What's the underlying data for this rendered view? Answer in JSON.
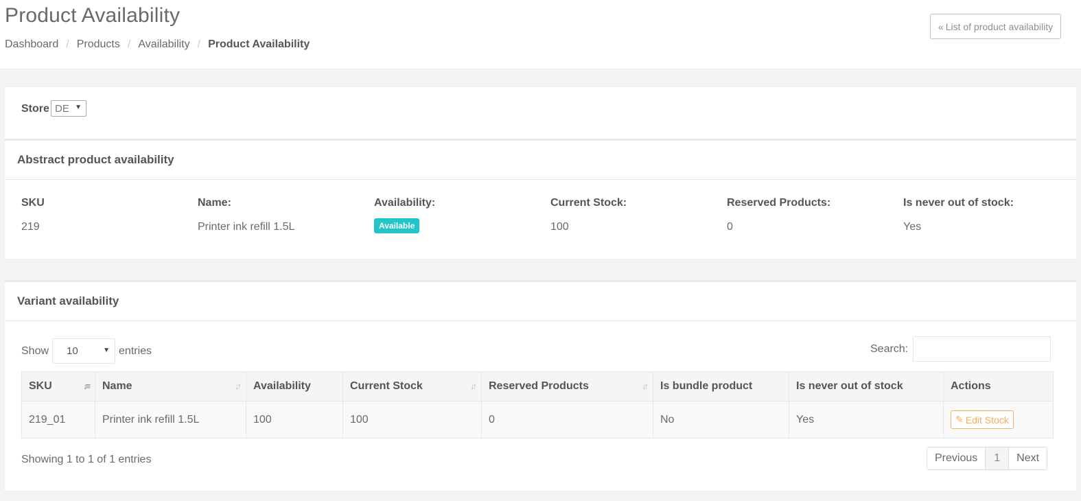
{
  "header": {
    "title": "Product Availability",
    "back_button": "List of product availability",
    "breadcrumb": [
      "Dashboard",
      "Products",
      "Availability",
      "Product Availability"
    ]
  },
  "store": {
    "label": "Store",
    "selected": "DE"
  },
  "abstract": {
    "title": "Abstract product availability",
    "columns": [
      "SKU",
      "Name:",
      "Availability:",
      "Current Stock:",
      "Reserved Products:",
      "Is never out of stock:"
    ],
    "values": {
      "sku": "219",
      "name": "Printer ink refill 1.5L",
      "availability": "Available",
      "current_stock": "100",
      "reserved": "0",
      "never_out": "Yes"
    }
  },
  "variant": {
    "title": "Variant availability",
    "show_label": "Show",
    "entries_label": "entries",
    "page_length": "10",
    "search_label": "Search:",
    "search_value": "",
    "columns": [
      "SKU",
      "Name",
      "Availability",
      "Current Stock",
      "Reserved Products",
      "Is bundle product",
      "Is never out of stock",
      "Actions"
    ],
    "rows": [
      {
        "sku": "219_01",
        "name": "Printer ink refill 1.5L",
        "availability": "100",
        "current_stock": "100",
        "reserved": "0",
        "bundle": "No",
        "never_out": "Yes",
        "action": "Edit Stock"
      }
    ],
    "info": "Showing 1 to 1 of 1 entries",
    "pager": {
      "previous": "Previous",
      "current": "1",
      "next": "Next"
    }
  },
  "colors": {
    "badge": "#23c6c8",
    "edit_button": "#f8ac59"
  },
  "icons": [
    "double-chevron-left-icon",
    "sort-icon",
    "edit-icon",
    "dropdown-arrow-icon"
  ]
}
